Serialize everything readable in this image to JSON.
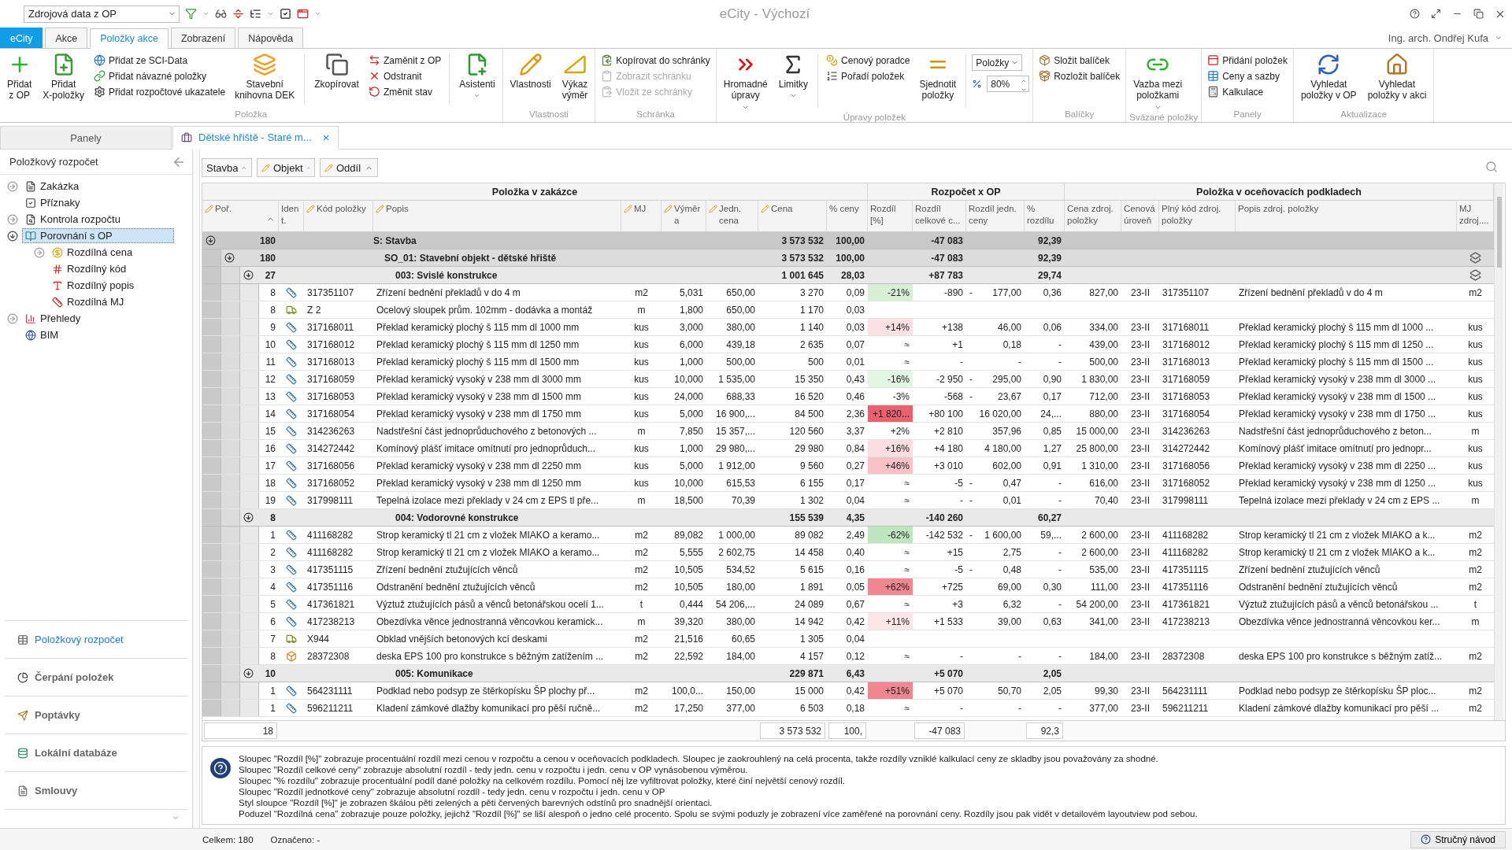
{
  "app": {
    "title": "eCity - Výchozí",
    "source_select": "Zdrojová data z OP",
    "user": "Ing. arch. Ondřej Kufa"
  },
  "menu_tabs": [
    {
      "label": "eCity",
      "kind": "app",
      "selected": false
    },
    {
      "label": "Akce",
      "kind": "tab",
      "selected": false
    },
    {
      "label": "Položky akce",
      "kind": "tab",
      "selected": true
    },
    {
      "label": "Zobrazení",
      "kind": "tab",
      "selected": false
    },
    {
      "label": "Nápověda",
      "kind": "tab",
      "selected": false
    }
  ],
  "ribbon": [
    {
      "label": "Položka",
      "items": [
        {
          "kind": "large",
          "label": "Přidat\nz OP",
          "dropdown": false
        },
        {
          "kind": "large",
          "label": "Přidat\nX-položky",
          "dropdown": false
        },
        {
          "kind": "stack",
          "entries": [
            {
              "label": "Přidat ze SCI-Data",
              "disabled": false
            },
            {
              "label": "Přidat návazné položky",
              "disabled": false
            },
            {
              "label": "Přidat rozpočtové ukazatele",
              "disabled": false
            }
          ]
        },
        {
          "kind": "large",
          "label": "Stavební\nknihovna DEK",
          "dropdown": false
        },
        {
          "kind": "separator"
        },
        {
          "kind": "large",
          "label": "Zkopírovat",
          "dropdown": false
        },
        {
          "kind": "stack",
          "entries": [
            {
              "label": "Zaměnit z OP",
              "disabled": false
            },
            {
              "label": "Odstranit",
              "disabled": false
            },
            {
              "label": "Změnit stav",
              "disabled": false
            }
          ]
        },
        {
          "kind": "separator"
        },
        {
          "kind": "large",
          "label": "Asistenti",
          "dropdown": true
        }
      ]
    },
    {
      "label": "Vlastnosti",
      "items": [
        {
          "kind": "large",
          "label": "Vlastnosti",
          "dropdown": false
        },
        {
          "kind": "large",
          "label": "Výkaz\nvýměr",
          "dropdown": false
        }
      ]
    },
    {
      "label": "Schránka",
      "items": [
        {
          "kind": "stack",
          "entries": [
            {
              "label": "Kopírovat do schránky",
              "disabled": false
            },
            {
              "label": "Zobrazit schránku",
              "disabled": true
            },
            {
              "label": "Vložit ze schránky",
              "disabled": true
            }
          ]
        }
      ]
    },
    {
      "label": "Úpravy položek",
      "items": [
        {
          "kind": "large",
          "label": "Hromadné\núpravy",
          "dropdown": true
        },
        {
          "kind": "large",
          "label": "Limitky",
          "dropdown": true
        },
        {
          "kind": "separator"
        },
        {
          "kind": "stack",
          "entries": [
            {
              "label": "Cenový poradce",
              "disabled": false
            },
            {
              "label": "Pořadí položek",
              "disabled": false
            }
          ]
        },
        {
          "kind": "large",
          "label": "Sjednotit\npoložky",
          "dropdown": false
        },
        {
          "kind": "separator"
        },
        {
          "kind": "combo",
          "select": "Položky",
          "spinner": "80%"
        }
      ]
    },
    {
      "label": "Balíčky",
      "items": [
        {
          "kind": "stack",
          "entries": [
            {
              "label": "Složit balíček",
              "disabled": false
            },
            {
              "label": "Rozložit balíček",
              "disabled": false
            }
          ]
        }
      ]
    },
    {
      "label": "Svázané položky",
      "items": [
        {
          "kind": "large",
          "label": "Vazba mezi\npoložkami",
          "dropdown": true
        }
      ]
    },
    {
      "label": "Panely",
      "items": [
        {
          "kind": "stack",
          "entries": [
            {
              "label": "Přidání položek",
              "disabled": false
            },
            {
              "label": "Ceny a sazby",
              "disabled": false
            },
            {
              "label": "Kalkulace",
              "disabled": false
            }
          ]
        }
      ]
    },
    {
      "label": "Aktualizace",
      "items": [
        {
          "kind": "large",
          "label": "Vyhledat\npoložky v OP",
          "dropdown": false
        },
        {
          "kind": "large",
          "label": "Vyhledat\npoložky v akci",
          "dropdown": false
        }
      ]
    }
  ],
  "panels_tab": "Panely",
  "document_tab": {
    "label": "Dětské hřiště  - Staré m...",
    "close": "×"
  },
  "sidebar": {
    "title": "Položkový rozpočet",
    "tree": [
      {
        "label": "Zakázka",
        "selected": false,
        "expanded": false
      },
      {
        "label": "Příznaky",
        "selected": false
      },
      {
        "label": "Kontrola rozpočtu",
        "selected": false,
        "expanded": false
      },
      {
        "label": "Porovnání s OP",
        "selected": true,
        "expanded": true,
        "children": [
          {
            "label": "Rozdílná cena",
            "selected": false,
            "expanded": false
          },
          {
            "label": "Rozdílný kód",
            "selected": false
          },
          {
            "label": "Rozdílný popis",
            "selected": false
          },
          {
            "label": "Rozdílná MJ",
            "selected": false
          }
        ]
      },
      {
        "label": "Přehledy",
        "selected": false,
        "expanded": false
      },
      {
        "label": "BIM",
        "selected": false
      }
    ],
    "nav": [
      {
        "label": "Položkový rozpočet",
        "selected": true
      },
      {
        "label": "Čerpání položek",
        "selected": false
      },
      {
        "label": "Poptávky",
        "selected": false
      },
      {
        "label": "Lokální databáze",
        "selected": false
      },
      {
        "label": "Smlouvy",
        "selected": false
      }
    ]
  },
  "filters": [
    {
      "label": "Stavba",
      "editable": false
    },
    {
      "label": "Objekt",
      "editable": true
    },
    {
      "label": "Oddíl",
      "editable": true
    }
  ],
  "table": {
    "column_groups": [
      {
        "label": "Položka v zakázce"
      },
      {
        "label": "Rozpočet x OP"
      },
      {
        "label": "Položka v oceňovacích podkladech"
      }
    ],
    "columns": [
      {
        "label": "Poř.",
        "editable": true,
        "sorted": true
      },
      {
        "label": "Ident.",
        "editable": false,
        "sorted": false
      },
      {
        "label": "Kód položky",
        "editable": true,
        "sorted": false
      },
      {
        "label": "Popis",
        "editable": true,
        "sorted": false
      },
      {
        "label": "MJ",
        "editable": true,
        "sorted": false
      },
      {
        "label": "Výměra",
        "editable": true,
        "sorted": false
      },
      {
        "label": "Jedn. cena",
        "editable": true,
        "sorted": false
      },
      {
        "label": "Cena",
        "editable": true,
        "sorted": false
      },
      {
        "label": "% ceny",
        "editable": false,
        "sorted": false
      },
      {
        "label": "Rozdíl [%]",
        "editable": false,
        "sorted": false
      },
      {
        "label": "Rozdíl celkové c...",
        "editable": false,
        "sorted": false
      },
      {
        "label": "Rozdíl jedn. ceny",
        "editable": false,
        "sorted": false
      },
      {
        "label": "% rozdílu",
        "editable": false,
        "sorted": false
      },
      {
        "label": "Cena zdroj. položky",
        "editable": false,
        "sorted": false
      },
      {
        "label": "Cenová úroveň",
        "editable": false,
        "sorted": false
      },
      {
        "label": "Plný kód zdroj. položky",
        "editable": false,
        "sorted": false
      },
      {
        "label": "Popis zdroj. položky",
        "editable": false,
        "sorted": false
      },
      {
        "label": "MJ zdroj....",
        "editable": false,
        "sorted": false
      }
    ],
    "rows": [
      {
        "kind": "group",
        "count": "180",
        "title": "S: Stavba",
        "price": "3 573 532",
        "share": "100,00",
        "diff_total": "-47 083",
        "diff_share": "92,39",
        "expanded": true,
        "linked": false,
        "children": [
          {
            "kind": "group",
            "count": "180",
            "title": "SO_01: Stavební objekt - dětské hřiště",
            "price": "3 573 532",
            "share": "100,00",
            "diff_total": "-47 083",
            "diff_share": "92,39",
            "expanded": true,
            "linked": true,
            "children": [
              {
                "kind": "group",
                "count": "27",
                "title": "003: Svislé konstrukce",
                "price": "1 001 645",
                "share": "28,03",
                "diff_total": "+87 783",
                "diff_share": "29,74",
                "expanded": true,
                "linked": true,
                "children": [
                  {
                    "kind": "catalog",
                    "por": "8",
                    "code": "317351107",
                    "desc": "Zřízení bednění překladů v do 4 m",
                    "mj": "m2",
                    "qty": "5,031",
                    "unit_price": "650,00",
                    "price": "3 270",
                    "share": "0,09",
                    "diff": "-21%",
                    "color": "#d5f0d5",
                    "diff_total": "-890",
                    "diff_unit_sign": "-",
                    "diff_unit": "177,00",
                    "diff_share": "0,36",
                    "src_price": "827,00",
                    "price_level": "23-II",
                    "src_code": "317351107",
                    "src_desc": "Zřízení bednění překladů v do 4 m",
                    "src_mj": "m2"
                  },
                  {
                    "kind": "custom",
                    "por": "8",
                    "code": "Z 2",
                    "desc": "Ocelový sloupek prům. 102mm - dodávka a montáž",
                    "mj": "m",
                    "qty": "1,800",
                    "unit_price": "650,00",
                    "price": "1 170",
                    "share": "0,03"
                  },
                  {
                    "kind": "catalog",
                    "por": "9",
                    "code": "317168011",
                    "desc": "Překlad keramický plochý š 115 mm dl 1000 mm",
                    "mj": "kus",
                    "qty": "3,000",
                    "unit_price": "380,00",
                    "price": "1 140",
                    "share": "0,03",
                    "diff": "+14%",
                    "color": "#fde0e3",
                    "diff_total": "+138",
                    "diff_unit": "46,00",
                    "diff_share": "0,06",
                    "src_price": "334,00",
                    "price_level": "23-II",
                    "src_code": "317168011",
                    "src_desc": "Překlad keramický plochý š 115 mm dl 1000 ...",
                    "src_mj": "kus"
                  },
                  {
                    "kind": "catalog",
                    "por": "10",
                    "code": "317168012",
                    "desc": "Překlad keramický plochý š 115 mm dl 1250 mm",
                    "mj": "kus",
                    "qty": "6,000",
                    "unit_price": "439,18",
                    "price": "2 635",
                    "share": "0,07",
                    "diff": "≈",
                    "diff_total": "+1",
                    "diff_unit": "0,18",
                    "diff_share": "-",
                    "src_price": "439,00",
                    "price_level": "23-II",
                    "src_code": "317168012",
                    "src_desc": "Překlad keramický plochý š 115 mm dl 1250 ...",
                    "src_mj": "kus"
                  },
                  {
                    "kind": "catalog",
                    "por": "11",
                    "code": "317168013",
                    "desc": "Překlad keramický plochý š 115 mm dl 1500 mm",
                    "mj": "kus",
                    "qty": "1,000",
                    "unit_price": "500,00",
                    "price": "500",
                    "share": "0,01",
                    "diff": "≈",
                    "diff_total": "-",
                    "diff_unit": "-",
                    "diff_share": "-",
                    "src_price": "500,00",
                    "price_level": "23-II",
                    "src_code": "317168013",
                    "src_desc": "Překlad keramický plochý š 115 mm dl 1500 ...",
                    "src_mj": "kus"
                  },
                  {
                    "kind": "catalog",
                    "por": "12",
                    "code": "317168059",
                    "desc": "Překlad keramický vysoký v 238 mm dl 3000 mm",
                    "mj": "kus",
                    "qty": "10,000",
                    "unit_price": "1 535,00",
                    "price": "15 350",
                    "share": "0,43",
                    "diff": "-16%",
                    "color": "#e3f5e3",
                    "diff_total": "-2 950",
                    "diff_unit_sign": "-",
                    "diff_unit": "295,00",
                    "diff_share": "0,90",
                    "src_price": "1 830,00",
                    "price_level": "23-II",
                    "src_code": "317168059",
                    "src_desc": "Překlad keramický vysoký v 238 mm dl 3000 ...",
                    "src_mj": "kus"
                  },
                  {
                    "kind": "catalog",
                    "por": "13",
                    "code": "317168053",
                    "desc": "Překlad keramický vysoký v 238 mm dl 1500 mm",
                    "mj": "kus",
                    "qty": "24,000",
                    "unit_price": "688,33",
                    "price": "16 520",
                    "share": "0,46",
                    "diff": "-3%",
                    "diff_total": "-568",
                    "diff_unit_sign": "-",
                    "diff_unit": "23,67",
                    "diff_share": "0,17",
                    "src_price": "712,00",
                    "price_level": "23-II",
                    "src_code": "317168053",
                    "src_desc": "Překlad keramický vysoký v 238 mm dl 1500 ...",
                    "src_mj": "kus"
                  },
                  {
                    "kind": "catalog",
                    "por": "14",
                    "code": "317168054",
                    "desc": "Překlad keramický vysoký v 238 mm dl 1750 mm",
                    "mj": "kus",
                    "qty": "5,000",
                    "unit_price": "16 900,...",
                    "price": "84 500",
                    "share": "2,36",
                    "diff": "+1 820...",
                    "color": "#e8616d",
                    "diff_total": "+80 100",
                    "diff_unit": "16 020,00",
                    "diff_share": "24,...",
                    "src_price": "880,00",
                    "price_level": "23-II",
                    "src_code": "317168054",
                    "src_desc": "Překlad keramický vysoký v 238 mm dl 1750 ...",
                    "src_mj": "kus"
                  },
                  {
                    "kind": "catalog",
                    "por": "15",
                    "code": "314236263",
                    "desc": "Nadstřešní část jednoprůduchového z betonových ...",
                    "mj": "m",
                    "qty": "7,850",
                    "unit_price": "15 357,...",
                    "price": "120 560",
                    "share": "3,37",
                    "diff": "+2%",
                    "diff_total": "+2 810",
                    "diff_unit": "357,96",
                    "diff_share": "0,85",
                    "src_price": "15 000,00",
                    "price_level": "23-II",
                    "src_code": "314236263",
                    "src_desc": "Nadstřešní část jednoprůduchového z beton...",
                    "src_mj": "m"
                  },
                  {
                    "kind": "catalog",
                    "por": "16",
                    "code": "314272442",
                    "desc": "Komínový plášť imitace omítnutí pro jednoprůduch...",
                    "mj": "kus",
                    "qty": "1,000",
                    "unit_price": "29 980,...",
                    "price": "29 980",
                    "share": "0,84",
                    "diff": "+16%",
                    "color": "#fcdde1",
                    "diff_total": "+4 180",
                    "diff_unit": "4 180,00",
                    "diff_share": "1,27",
                    "src_price": "25 800,00",
                    "price_level": "23-II",
                    "src_code": "314272442",
                    "src_desc": "Komínový plášť imitace omítnutí pro jednopr...",
                    "src_mj": "kus"
                  },
                  {
                    "kind": "catalog",
                    "por": "17",
                    "code": "317168056",
                    "desc": "Překlad keramický vysoký v 238 mm dl 2250 mm",
                    "mj": "kus",
                    "qty": "5,000",
                    "unit_price": "1 912,00",
                    "price": "9 560",
                    "share": "0,27",
                    "diff": "+46%",
                    "color": "#f8c2c7",
                    "diff_total": "+3 010",
                    "diff_unit": "602,00",
                    "diff_share": "0,91",
                    "src_price": "1 310,00",
                    "price_level": "23-II",
                    "src_code": "317168056",
                    "src_desc": "Překlad keramický vysoký v 238 mm dl 2250 ...",
                    "src_mj": "kus"
                  },
                  {
                    "kind": "catalog",
                    "por": "18",
                    "code": "317168052",
                    "desc": "Překlad keramický vysoký v 238 mm dl 1250 mm",
                    "mj": "kus",
                    "qty": "10,000",
                    "unit_price": "615,53",
                    "price": "6 155",
                    "share": "0,17",
                    "diff": "≈",
                    "diff_total": "-5",
                    "diff_unit_sign": "-",
                    "diff_unit": "0,47",
                    "diff_share": "-",
                    "src_price": "616,00",
                    "price_level": "23-II",
                    "src_code": "317168052",
                    "src_desc": "Překlad keramický vysoký v 238 mm dl 1250 ...",
                    "src_mj": "kus"
                  },
                  {
                    "kind": "catalog",
                    "por": "19",
                    "code": "317998111",
                    "desc": "Tepelná izolace mezi překlady v 24 cm z EPS tl pře...",
                    "mj": "m",
                    "qty": "18,500",
                    "unit_price": "70,39",
                    "price": "1 302",
                    "share": "0,04",
                    "diff": "≈",
                    "diff_total": "-",
                    "diff_unit_sign": "-",
                    "diff_unit": "0,01",
                    "diff_share": "-",
                    "src_price": "70,40",
                    "price_level": "23-II",
                    "src_code": "317998111",
                    "src_desc": "Tepelná izolace mezi překlady v 24 cm z EPS ...",
                    "src_mj": "m"
                  }
                ]
              },
              {
                "kind": "group",
                "count": "8",
                "title": "004: Vodorovné konstrukce",
                "price": "155 539",
                "share": "4,35",
                "diff_total": "-140 260",
                "diff_share": "60,27",
                "expanded": true,
                "linked": false,
                "children": [
                  {
                    "kind": "catalog",
                    "por": "1",
                    "code": "411168282",
                    "desc": "Strop keramický tl 21 cm z vložek MIAKO a keramo...",
                    "mj": "m2",
                    "qty": "89,082",
                    "unit_price": "1 000,00",
                    "price": "89 082",
                    "share": "2,49",
                    "diff": "-62%",
                    "color": "#bfe6bf",
                    "diff_total": "-142 532",
                    "diff_unit_sign": "-",
                    "diff_unit": "1 600,00",
                    "diff_share": "59,...",
                    "src_price": "2 600,00",
                    "price_level": "23-II",
                    "src_code": "411168282",
                    "src_desc": "Strop keramický tl 21 cm z vložek MIAKO a k...",
                    "src_mj": "m2"
                  },
                  {
                    "kind": "catalog",
                    "por": "2",
                    "code": "411168282",
                    "desc": "Strop keramický tl 21 cm z vložek MIAKO a keramo...",
                    "mj": "m2",
                    "qty": "5,555",
                    "unit_price": "2 602,75",
                    "price": "14 458",
                    "share": "0,40",
                    "diff": "≈",
                    "diff_total": "+15",
                    "diff_unit": "2,75",
                    "diff_share": "-",
                    "src_price": "2 600,00",
                    "price_level": "23-II",
                    "src_code": "411168282",
                    "src_desc": "Strop keramický tl 21 cm z vložek MIAKO a k...",
                    "src_mj": "m2"
                  },
                  {
                    "kind": "catalog",
                    "por": "3",
                    "code": "417351115",
                    "desc": "Zřízení bednění ztužujících věnců",
                    "mj": "m2",
                    "qty": "10,505",
                    "unit_price": "534,52",
                    "price": "5 615",
                    "share": "0,16",
                    "diff": "≈",
                    "diff_total": "-5",
                    "diff_unit_sign": "-",
                    "diff_unit": "0,48",
                    "diff_share": "-",
                    "src_price": "535,00",
                    "price_level": "23-II",
                    "src_code": "417351115",
                    "src_desc": "Zřízení bednění ztužujících věnců",
                    "src_mj": "m2"
                  },
                  {
                    "kind": "catalog",
                    "por": "4",
                    "code": "417351116",
                    "desc": "Odstranění bednění ztužujících věnců",
                    "mj": "m2",
                    "qty": "10,505",
                    "unit_price": "180,00",
                    "price": "1 891",
                    "share": "0,05",
                    "diff": "+62%",
                    "color": "#f0868f",
                    "diff_total": "+725",
                    "diff_unit": "69,00",
                    "diff_share": "0,30",
                    "src_price": "111,00",
                    "price_level": "23-II",
                    "src_code": "417351116",
                    "src_desc": "Odstranění bednění ztužujících věnců",
                    "src_mj": "m2"
                  },
                  {
                    "kind": "catalog",
                    "por": "5",
                    "code": "417361821",
                    "desc": "Výztuž ztužujících pásů a věnců betonářskou ocelí 1...",
                    "mj": "t",
                    "qty": "0,444",
                    "unit_price": "54 206,...",
                    "price": "24 089",
                    "share": "0,67",
                    "diff": "≈",
                    "diff_total": "+3",
                    "diff_unit": "6,32",
                    "diff_share": "-",
                    "src_price": "54 200,00",
                    "price_level": "23-II",
                    "src_code": "417361821",
                    "src_desc": "Výztuž ztužujících pásů a věnců betonářskou ...",
                    "src_mj": "t"
                  },
                  {
                    "kind": "catalog",
                    "por": "6",
                    "code": "417238213",
                    "desc": "Obezdívka věnce jednostranná věncovkou keramick...",
                    "mj": "m",
                    "qty": "39,320",
                    "unit_price": "380,00",
                    "price": "14 942",
                    "share": "0,42",
                    "diff": "+11%",
                    "color": "#fde6e8",
                    "diff_total": "+1 533",
                    "diff_unit": "39,00",
                    "diff_share": "0,63",
                    "src_price": "341,00",
                    "price_level": "23-II",
                    "src_code": "417238213",
                    "src_desc": "Obezdívka věnce jednostranná věncovkou ker...",
                    "src_mj": "m"
                  },
                  {
                    "kind": "custom",
                    "por": "7",
                    "code": "X944",
                    "desc": "Obklad vnějších betonových kcí deskami",
                    "mj": "m2",
                    "qty": "21,516",
                    "unit_price": "60,65",
                    "price": "1 305",
                    "share": "0,04"
                  },
                  {
                    "kind": "material",
                    "por": "8",
                    "code": "28372308",
                    "desc": "deska EPS 100 pro konstrukce s běžným zatížením ...",
                    "mj": "m2",
                    "qty": "22,592",
                    "unit_price": "184,00",
                    "price": "4 157",
                    "share": "0,12",
                    "diff": "≈",
                    "diff_total": "-",
                    "diff_unit": "-",
                    "diff_share": "-",
                    "src_price": "184,00",
                    "price_level": "23-II",
                    "src_code": "28372308",
                    "src_desc": "deska EPS 100 pro konstrukce s běžným zatíž...",
                    "src_mj": "m2"
                  }
                ]
              },
              {
                "kind": "group",
                "count": "10",
                "title": "005: Komunikace",
                "price": "229 871",
                "share": "6,43",
                "diff_total": "+5 070",
                "diff_share": "2,05",
                "expanded": true,
                "linked": false,
                "children": [
                  {
                    "kind": "catalog",
                    "por": "1",
                    "code": "564231111",
                    "desc": "Podklad nebo podsyp ze štěrkopísku ŠP plochy př...",
                    "mj": "m2",
                    "qty": "100,0...",
                    "unit_price": "150,00",
                    "price": "15 000",
                    "share": "0,42",
                    "diff": "+51%",
                    "color": "#f0868f",
                    "diff_total": "+5 070",
                    "diff_unit": "50,70",
                    "diff_share": "2,05",
                    "src_price": "99,30",
                    "price_level": "23-II",
                    "src_code": "564231111",
                    "src_desc": "Podklad nebo podsyp ze štěrkopísku ŠP ploc...",
                    "src_mj": "m2"
                  },
                  {
                    "kind": "catalog",
                    "por": "1",
                    "code": "596211211",
                    "desc": "Kladení zámkové dlažby komunikací pro pěší ručně...",
                    "mj": "m2",
                    "qty": "17,250",
                    "unit_price": "377,00",
                    "price": "6 503",
                    "share": "0,18",
                    "diff": "≈",
                    "diff_total": "-",
                    "diff_unit": "-",
                    "diff_share": "-",
                    "src_price": "377,00",
                    "price_level": "23-II",
                    "src_code": "596211211",
                    "src_desc": "Kladení zámkové dlažby komunikací pro pěší ...",
                    "src_mj": "m2"
                  }
                ]
              }
            ]
          }
        ]
      }
    ],
    "totals": {
      "count": "18",
      "price": "3 573 532",
      "share": "100,",
      "diff_total": "-47 083",
      "diff_share": "92,3"
    }
  },
  "help": [
    "Sloupec \"Rozdíl [%]\" zobrazuje procentuální rozdíl mezi cenou v rozpočtu a cenou v oceňovacích podkladech. Sloupec je zaokrouhlený na celá procenta, takže rozdíly vzniklé kalkulací ceny ze skladby jsou považovány za shodné.",
    "Sloupec \"Rozdíl celkové ceny\" zobrazuje absolutní rozdíl - tedy jedn. cenu v rozpočtu i jedn. cenu v OP vynásobenou výměrou.",
    "Sloupec \"% rozdílu\" zobrazuje procentuální podíl dané položky na celkovém rozdílu. Pomocí něj lze vyfiltrovat položky, které činí největší cenový rozdíl.",
    "Sloupec \"Rozdíl jednotkové ceny\" zobrazuje absolutní rozdíl - tedy jedn. cenu v rozpočtu i jedn. cenu v OP",
    "Styl sloupce \"Rozdíl [%]\" je zobrazen škálou pěti zelených a pěti červených barevných odstínů pro snadnější orientaci.",
    "Poduzel \"Rozdílná cena\" zobrazuje pouze položky, jejichž \"Rozdíl [%]\" se liší alespoň o jedno celé procento. Spolu se svými poduzly je zobrazení více zaměřené na porovnání ceny. Rozdíly jsou pak vidět v detailovém layoutview pod sebou."
  ],
  "status": {
    "total": "Celkem: 180",
    "marked": "Označeno: -",
    "guide": "Stručný návod"
  }
}
